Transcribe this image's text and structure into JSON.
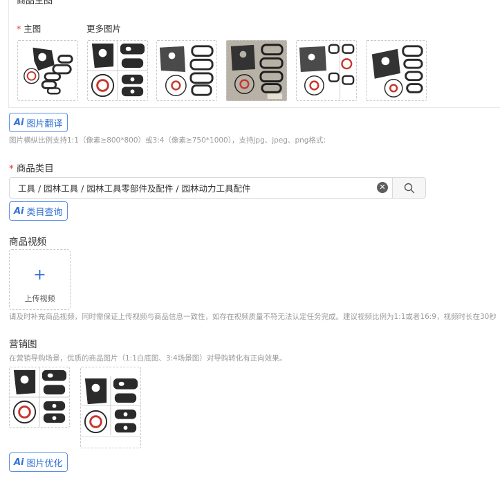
{
  "images": {
    "panel_title": "商品主图",
    "main_label": "主图",
    "more_label": "更多图片",
    "translate_button": "图片翻译",
    "hint": "图片横纵比例支持1:1（像素≥800*800）或3:4（像素≥750*1000），支持jpg、jpeg、png格式;"
  },
  "category": {
    "title": "商品类目",
    "path": "工具 / 园林工具 / 园林工具零部件及配件 / 园林动力工具配件",
    "query_button": "类目查询"
  },
  "video": {
    "title": "商品视频",
    "upload_label": "上传视频",
    "upload_plus": "+",
    "hint": "请及时补充商品视频，同时需保证上传视频与商品信息一致性，如存在视频质量不符无法认定任务完成。建议视频比例为1:1或者16:9，视频时长在30秒"
  },
  "marketing": {
    "title": "营销图",
    "hint": "在营销导购场景，优质的商品图片（1:1白底图、3:4场景图）对导购转化有正向效果。",
    "optimize_button": "图片优化"
  },
  "ai_mark": "Ai",
  "icons": {
    "clear": "clear-circle-icon",
    "search": "search-icon",
    "ai": "ai-icon"
  },
  "colors": {
    "accent": "#2f6fd6",
    "required": "#e0322c",
    "gasket_red": "#c8352c",
    "gasket_dark": "#2b2b2b"
  }
}
